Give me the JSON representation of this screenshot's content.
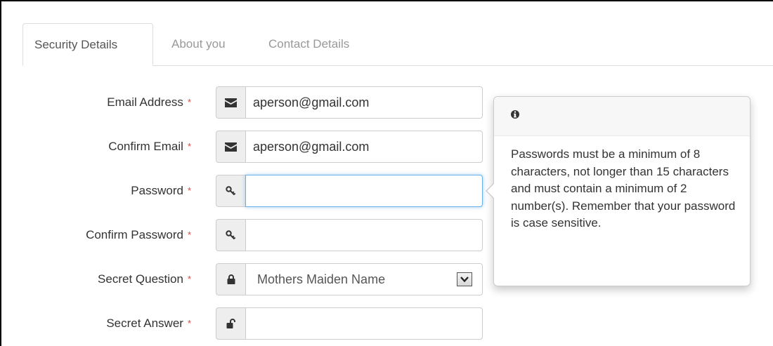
{
  "tabs": [
    {
      "label": "Security Details",
      "active": true
    },
    {
      "label": "About you",
      "active": false
    },
    {
      "label": "Contact Details",
      "active": false
    }
  ],
  "form": {
    "required_marker": "*",
    "fields": [
      {
        "label": "Email Address",
        "icon": "envelope-icon",
        "type": "text",
        "value": "aperson@gmail.com"
      },
      {
        "label": "Confirm Email",
        "icon": "envelope-icon",
        "type": "text",
        "value": "aperson@gmail.com"
      },
      {
        "label": "Password",
        "icon": "key-icon",
        "type": "password",
        "value": "",
        "focused": true
      },
      {
        "label": "Confirm Password",
        "icon": "key-icon",
        "type": "password",
        "value": ""
      },
      {
        "label": "Secret Question",
        "icon": "lock-icon",
        "type": "select",
        "value": "Mothers Maiden Name"
      },
      {
        "label": "Secret Answer",
        "icon": "unlock-icon",
        "type": "text",
        "value": ""
      }
    ]
  },
  "popover": {
    "icon": "info-icon",
    "content": "Passwords must be a minimum of 8 characters, not longer than 15 characters and must contain a minimum of 2 number(s). Remember that your password is case sensitive."
  },
  "colors": {
    "required": "#e0463d",
    "focus_border": "#66afe9",
    "addon_bg": "#eeeeee",
    "border": "#cccccc"
  }
}
